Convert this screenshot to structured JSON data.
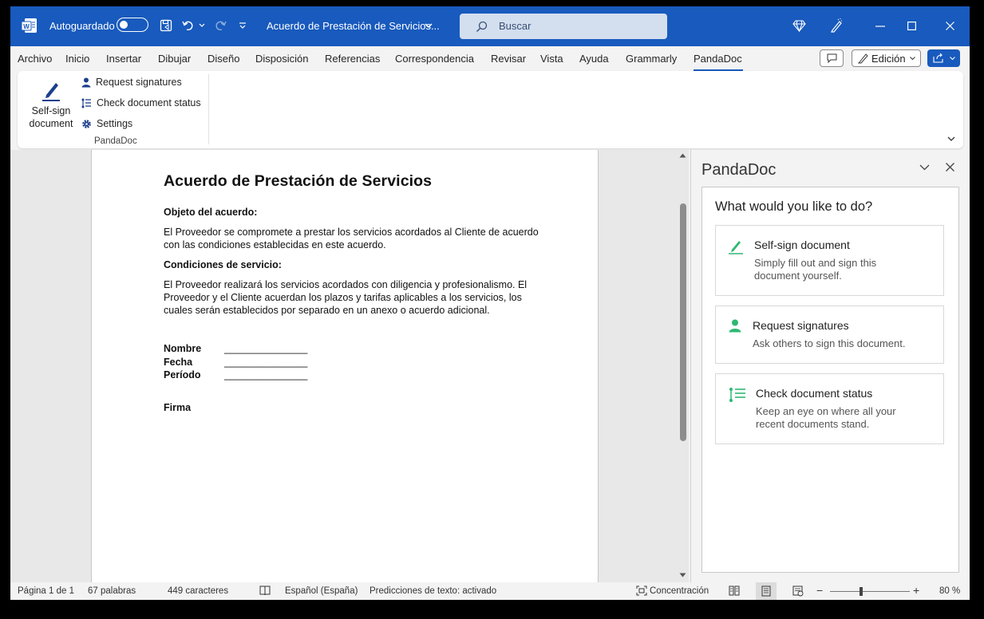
{
  "titlebar": {
    "autosave_label": "Autoguardado",
    "doc_title": "Acuerdo de Prestación de Servicios...",
    "search_placeholder": "Buscar"
  },
  "menu": {
    "tabs": [
      "Archivo",
      "Inicio",
      "Insertar",
      "Dibujar",
      "Diseño",
      "Disposición",
      "Referencias",
      "Correspondencia",
      "Revisar",
      "Vista",
      "Ayuda",
      "Grammarly",
      "PandaDoc"
    ],
    "active_tab": "PandaDoc",
    "edit_mode_label": "Edición"
  },
  "ribbon": {
    "self_sign_line1": "Self-sign",
    "self_sign_line2": "document",
    "request_signatures": "Request signatures",
    "check_status": "Check document status",
    "settings": "Settings",
    "group_label": "PandaDoc"
  },
  "document": {
    "title": "Acuerdo de Prestación de Servicios",
    "section1_heading": "Objeto del acuerdo:",
    "section1_text": "El Proveedor se compromete a prestar los servicios acordados al Cliente de acuerdo con las condiciones establecidas en este acuerdo.",
    "section2_heading": "Condiciones de servicio:",
    "section2_text": "El Proveedor realizará los servicios acordados con diligencia y profesionalismo. El Proveedor y el Cliente acuerdan los plazos y tarifas aplicables a los servicios, los cuales serán establecidos por separado en un anexo o acuerdo adicional.",
    "fields": [
      {
        "label": "Nombre",
        "value": "_______________"
      },
      {
        "label": "Fecha",
        "value": "_______________"
      },
      {
        "label": "Período",
        "value": "_______________"
      }
    ],
    "signature_label": "Firma"
  },
  "pane": {
    "title": "PandaDoc",
    "question": "What would you like to do?",
    "cards": [
      {
        "title": "Self-sign document",
        "desc": "Simply fill out and sign this document yourself."
      },
      {
        "title": "Request signatures",
        "desc": "Ask others to sign this document."
      },
      {
        "title": "Check document status",
        "desc": "Keep an eye on where all your recent documents stand."
      }
    ]
  },
  "statusbar": {
    "page": "Página 1 de 1",
    "words": "67 palabras",
    "chars": "449 caracteres",
    "language": "Español (España)",
    "predictions": "Predicciones de texto: activado",
    "focus": "Concentración",
    "zoom": "80 %",
    "zoom_level": 0.8
  },
  "colors": {
    "titlebar": "#185abd",
    "pandadoc_green": "#2eb872"
  }
}
